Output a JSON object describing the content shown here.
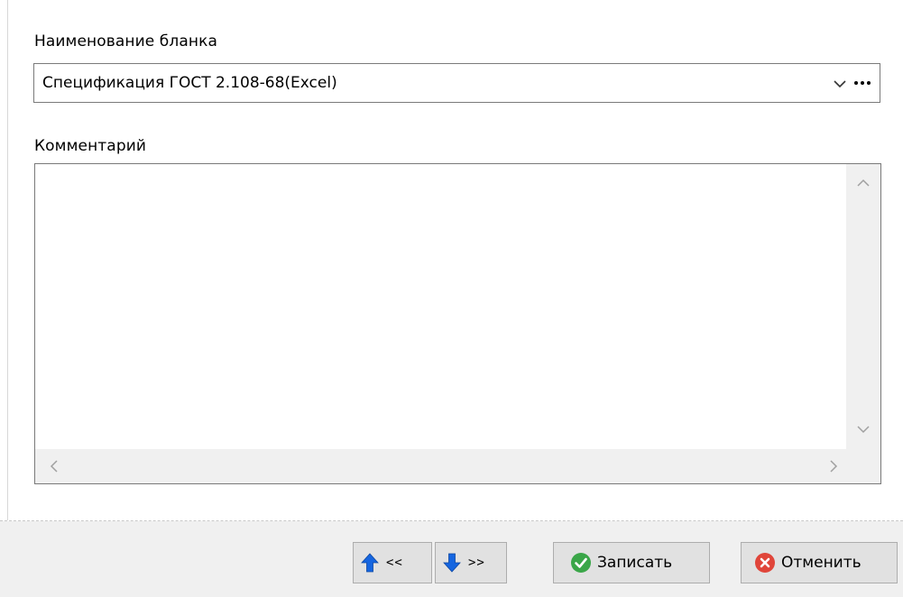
{
  "form": {
    "name_label": "Наименование бланка",
    "name_value": "Спецификация ГОСТ 2.108-68(Excel)",
    "comment_label": "Комментарий",
    "comment_value": ""
  },
  "icons": {
    "dropdown": "chevron-down-icon",
    "ellipsis": "ellipsis-icon",
    "prev": "arrow-up-icon",
    "next": "arrow-down-icon",
    "save": "check-circle-icon",
    "cancel": "close-circle-icon"
  },
  "colors": {
    "arrow_blue": "#1565e0",
    "save_green": "#3aa648",
    "cancel_red": "#e0453a"
  },
  "footer": {
    "prev_label": "<<",
    "next_label": ">>",
    "save_label": "Записать",
    "cancel_label": "Отменить"
  }
}
